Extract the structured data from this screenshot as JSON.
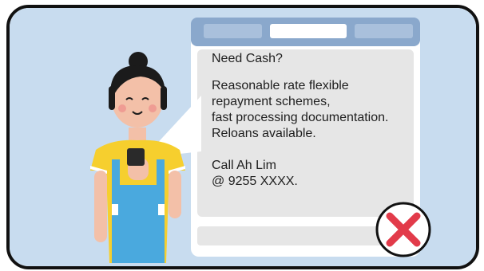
{
  "message": {
    "lines": [
      "Need Cash?",
      "Reasonable rate flexible",
      "repayment schemes,",
      "fast processing documentation.",
      "Reloans available.",
      "Call Ah Lim",
      "@ 9255 XXXX."
    ]
  },
  "colors": {
    "background": "#c8dcef",
    "phone_frame": "#8aa8cc",
    "screen": "#e6e6e6",
    "bubble": "#ffffff",
    "shirt": "#f6cf2e",
    "apron": "#4aa9de",
    "reject_mark": "#e23b4a"
  },
  "icons": {
    "reject": "close-icon"
  }
}
